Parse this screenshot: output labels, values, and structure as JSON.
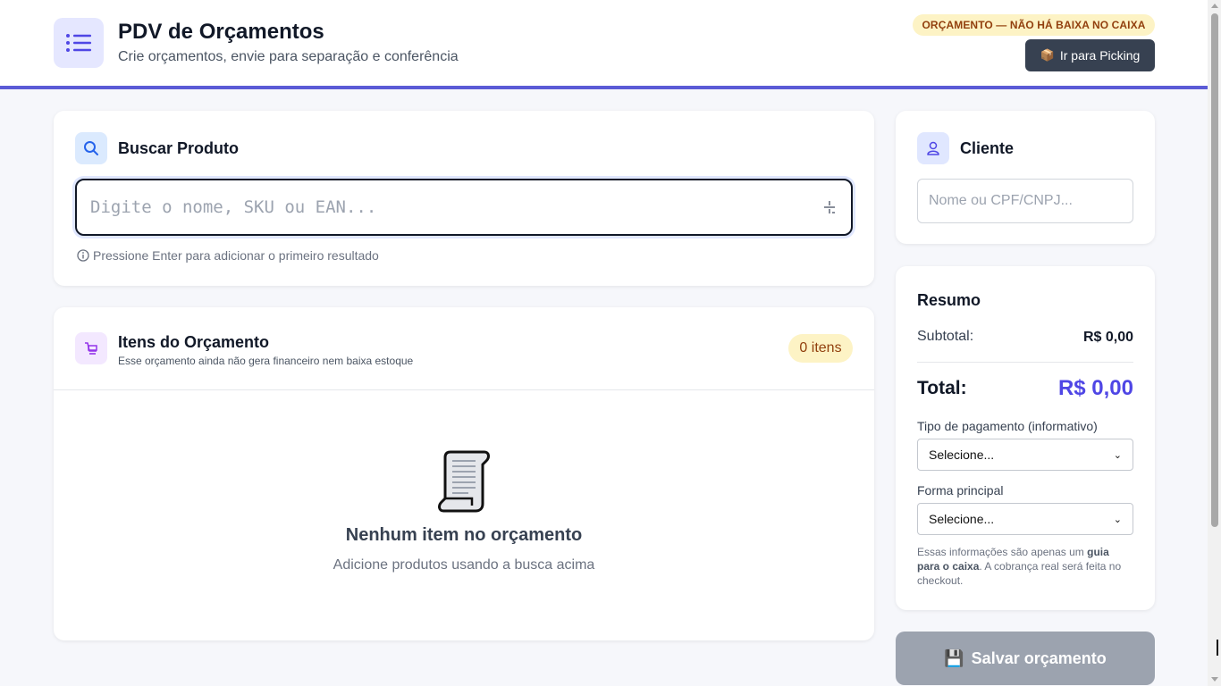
{
  "header": {
    "title": "PDV de Orçamentos",
    "subtitle": "Crie orçamentos, envie para separação e conferência",
    "warning_badge": "ORÇAMENTO — NÃO HÁ BAIXA NO CAIXA",
    "picking_button": "Ir para Picking",
    "picking_icon": "package-emoji"
  },
  "search": {
    "title": "Buscar Produto",
    "placeholder": "Digite o nome, SKU ou EAN...",
    "value": "",
    "hint": "Pressione Enter para adicionar o primeiro resultado"
  },
  "items": {
    "title": "Itens do Orçamento",
    "subtitle": "Esse orçamento ainda não gera financeiro nem baixa estoque",
    "count_badge": "0 itens",
    "empty_title": "Nenhum item no orçamento",
    "empty_subtitle": "Adicione produtos usando a busca acima"
  },
  "client": {
    "title": "Cliente",
    "placeholder": "Nome ou CPF/CNPJ...",
    "value": ""
  },
  "summary": {
    "title": "Resumo",
    "subtotal_label": "Subtotal:",
    "subtotal_value": "R$ 0,00",
    "total_label": "Total:",
    "total_value": "R$ 0,00",
    "payment_type_label": "Tipo de pagamento (informativo)",
    "payment_type_value": "Selecione...",
    "main_method_label": "Forma principal",
    "main_method_value": "Selecione...",
    "note_part1": "Essas informações são apenas um ",
    "note_bold": "guia para o caixa",
    "note_part2": ". A cobrança real será feita no checkout."
  },
  "actions": {
    "save_button": "Salvar orçamento"
  },
  "colors": {
    "accent": "#4f46e5",
    "header_border": "#5b5bd6",
    "badge_bg": "#fdf3c5",
    "badge_text": "#92400e",
    "dark_button": "#374151",
    "disabled_button": "#9ca3af"
  }
}
